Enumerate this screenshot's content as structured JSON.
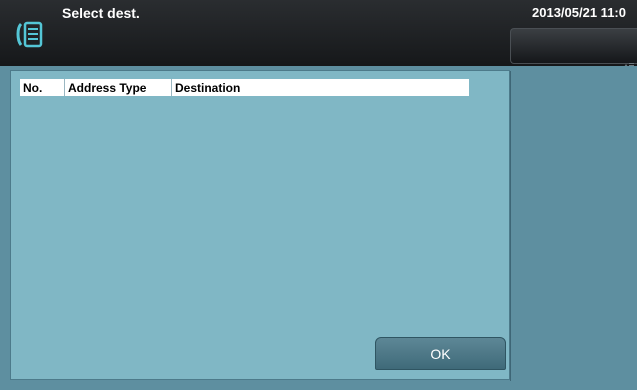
{
  "header": {
    "title": "Select dest.",
    "datetime": "2013/05/21 11:0",
    "mode_icon": "fax-icon"
  },
  "table": {
    "columns": [
      "No.",
      "Address Type",
      "Destination"
    ]
  },
  "buttons": {
    "ok_label": "OK"
  },
  "colors": {
    "header_bg": "#1f2225",
    "background": "#5e8fa0",
    "dialog_bg": "#80b7c5",
    "button_bg": "#4c7786"
  }
}
